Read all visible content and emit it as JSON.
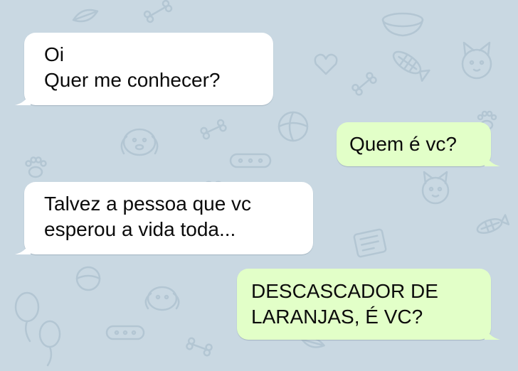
{
  "colors": {
    "background": "#c9d8e2",
    "incoming_bubble": "#ffffff",
    "outgoing_bubble": "#e2ffc8",
    "doodle_stroke": "#b3c6d3"
  },
  "wallpaper": {
    "icons": [
      "bone-icon",
      "fish-skeleton-icon",
      "ball-icon",
      "paw-icon",
      "cat-icon",
      "dog-icon",
      "collar-icon",
      "bowl-icon",
      "heart-icon",
      "balloon-icon",
      "leaf-icon",
      "bag-icon"
    ]
  },
  "messages": [
    {
      "direction": "incoming",
      "lines": [
        "Oi",
        "Quer me conhecer?"
      ]
    },
    {
      "direction": "outgoing",
      "lines": [
        "Quem é vc?"
      ]
    },
    {
      "direction": "incoming",
      "lines": [
        "Talvez a pessoa que vc",
        "esperou a vida toda..."
      ]
    },
    {
      "direction": "outgoing",
      "lines": [
        "DESCASCADOR DE",
        "LARANJAS, É VC?"
      ]
    }
  ]
}
